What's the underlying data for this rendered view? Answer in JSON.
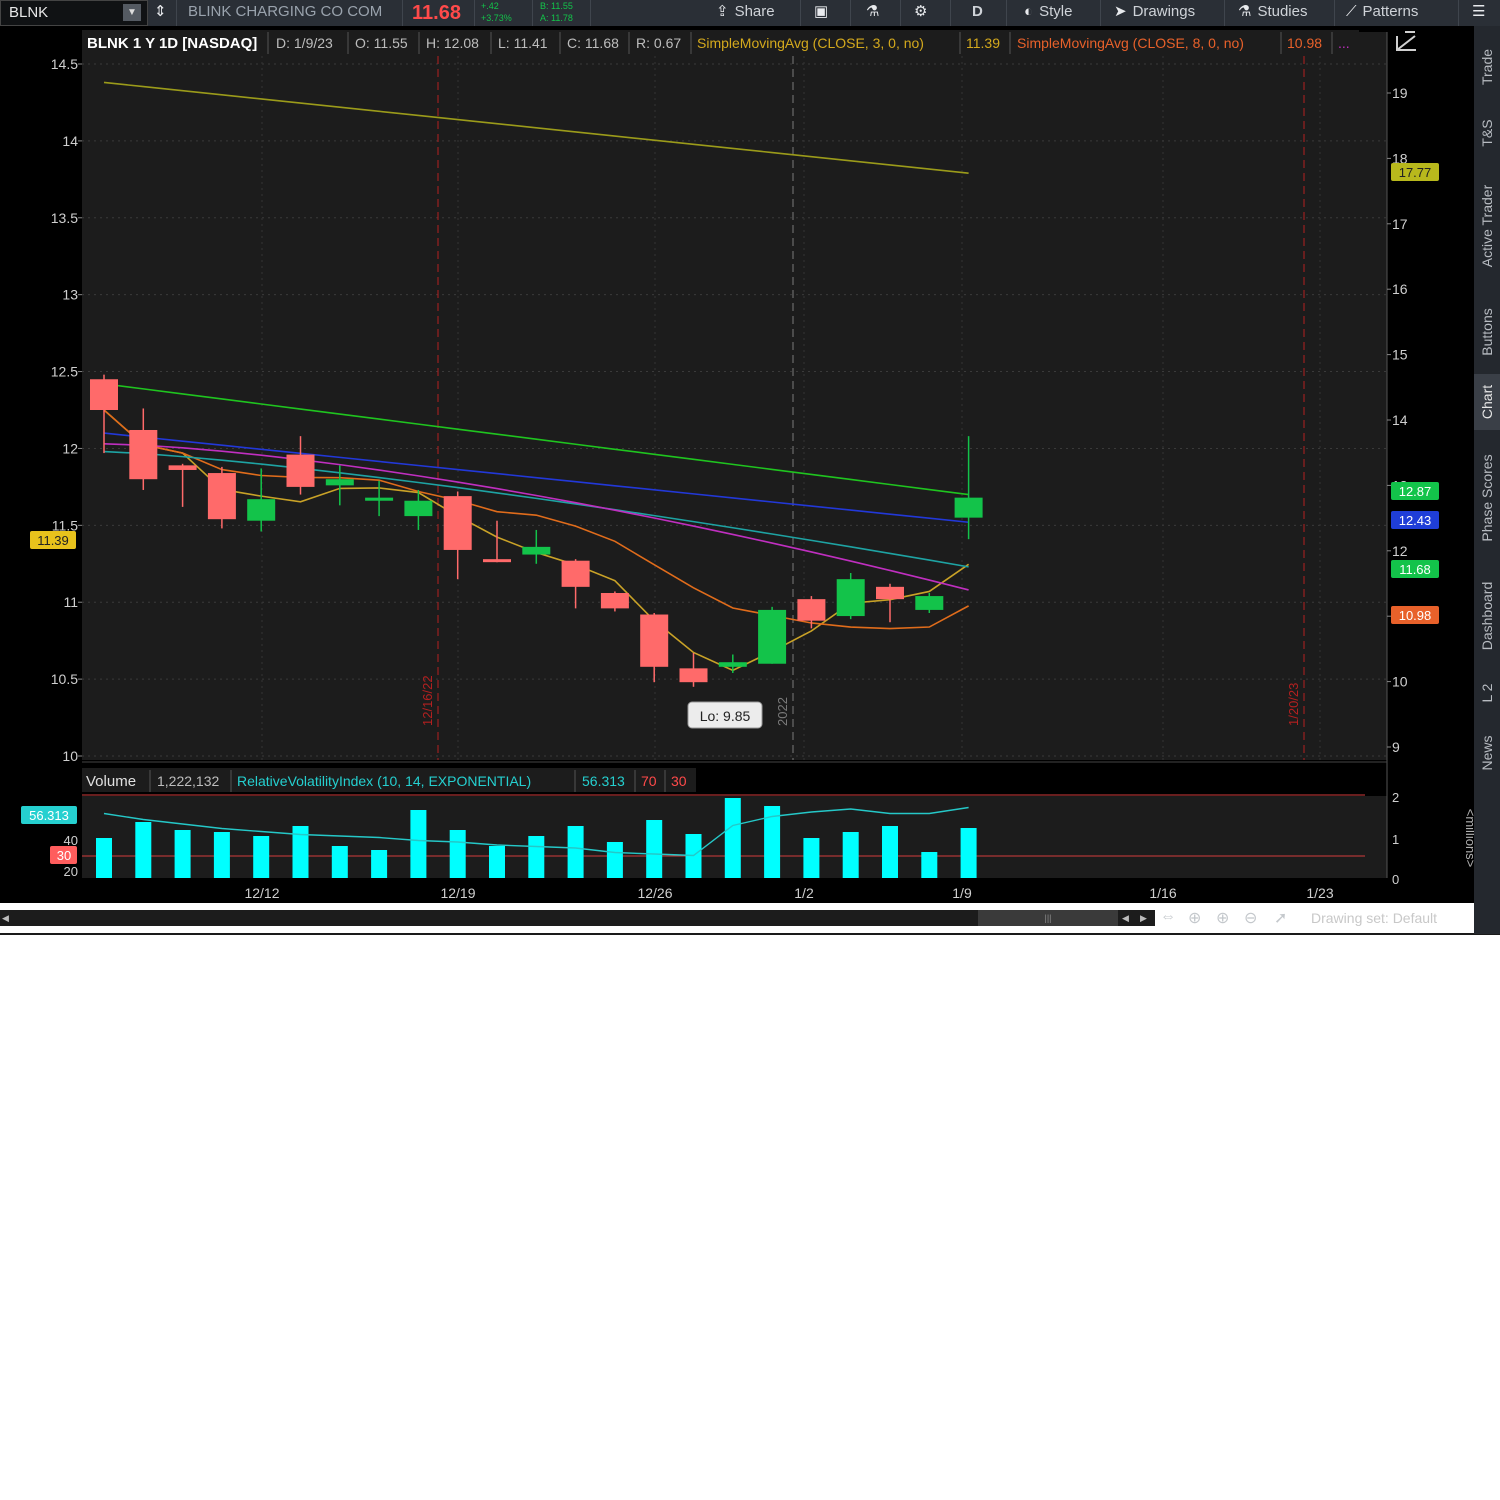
{
  "toolbar": {
    "symbol": "BLNK",
    "company": "BLINK CHARGING CO COM",
    "last_price": "11.68",
    "change": "+.42",
    "change_pct": "+3.73%",
    "bid": "B: 11.55",
    "ask": "A: 11.78",
    "share": "Share",
    "timeframe": "D",
    "style": "Style",
    "drawings": "Drawings",
    "studies": "Studies",
    "patterns": "Patterns"
  },
  "header": {
    "title": "BLNK 1 Y 1D [NASDAQ]",
    "date": "D: 1/9/23",
    "open": "O: 11.55",
    "high": "H: 12.08",
    "low": "L: 11.41",
    "close": "C: 11.68",
    "range": "R: 0.67",
    "sma3_label": "SimpleMovingAvg (CLOSE, 3, 0, no)",
    "sma3_value": "11.39",
    "sma8_label": "SimpleMovingAvg (CLOSE, 8, 0, no)",
    "sma8_value": "10.98",
    "more": "..."
  },
  "lower_header": {
    "volume_label": "Volume",
    "volume_value": "1,222,132",
    "rvi_label": "RelativeVolatilityIndex (10, 14, EXPONENTIAL)",
    "rvi_value": "56.313",
    "upper": "70",
    "lower": "30"
  },
  "colors": {
    "up": "#13c34a",
    "down": "#ff6a6a",
    "volume": "#00ffff",
    "sma3": "#c9a227",
    "sma8": "#e06c1b",
    "green_ma": "#1fc41f",
    "blue_ma": "#2238d8",
    "magenta_ma": "#c02fc0",
    "teal_ma": "#1ea3a3",
    "olive_ma": "#9b9b1a"
  },
  "chart_data": {
    "type": "candlestick",
    "title": "BLNK 1 Y 1D [NASDAQ]",
    "y_left_range": [
      10,
      14.5
    ],
    "y_left_ticks": [
      "14.5",
      "14",
      "13.5",
      "13",
      "12.5",
      "12",
      "11.5",
      "11",
      "10.5",
      "10"
    ],
    "y_right_ticks": [
      "19",
      "18",
      "17",
      "16",
      "15",
      "14",
      "13",
      "12",
      "11",
      "10",
      "9"
    ],
    "x_tick_labels": [
      "12/12",
      "12/19",
      "12/26",
      "1/2",
      "1/9",
      "1/16",
      "1/23"
    ],
    "period_markers": [
      "12/16/22",
      "2022",
      "1/20/23"
    ],
    "candles": [
      {
        "o": 12.45,
        "h": 12.48,
        "l": 11.97,
        "c": 12.25
      },
      {
        "o": 12.12,
        "h": 12.26,
        "l": 11.73,
        "c": 11.8
      },
      {
        "o": 11.89,
        "h": 11.9,
        "l": 11.62,
        "c": 11.86
      },
      {
        "o": 11.84,
        "h": 11.88,
        "l": 11.48,
        "c": 11.54
      },
      {
        "o": 11.53,
        "h": 11.87,
        "l": 11.46,
        "c": 11.67
      },
      {
        "o": 11.96,
        "h": 12.08,
        "l": 11.7,
        "c": 11.75
      },
      {
        "o": 11.76,
        "h": 11.89,
        "l": 11.63,
        "c": 11.8
      },
      {
        "o": 11.66,
        "h": 11.79,
        "l": 11.56,
        "c": 11.68
      },
      {
        "o": 11.56,
        "h": 11.73,
        "l": 11.47,
        "c": 11.66
      },
      {
        "o": 11.69,
        "h": 11.72,
        "l": 11.15,
        "c": 11.34
      },
      {
        "o": 11.28,
        "h": 11.53,
        "l": 11.26,
        "c": 11.27
      },
      {
        "o": 11.31,
        "h": 11.47,
        "l": 11.25,
        "c": 11.36
      },
      {
        "o": 11.27,
        "h": 11.28,
        "l": 10.96,
        "c": 11.1
      },
      {
        "o": 11.06,
        "h": 11.07,
        "l": 10.94,
        "c": 10.96
      },
      {
        "o": 10.92,
        "h": 10.93,
        "l": 10.48,
        "c": 10.58
      },
      {
        "o": 10.57,
        "h": 10.67,
        "l": 10.45,
        "c": 10.48
      },
      {
        "o": 10.58,
        "h": 10.66,
        "l": 10.54,
        "c": 10.61
      },
      {
        "o": 10.6,
        "h": 10.97,
        "l": 10.6,
        "c": 10.95
      },
      {
        "o": 11.02,
        "h": 11.04,
        "l": 10.83,
        "c": 10.88
      },
      {
        "o": 10.91,
        "h": 11.19,
        "l": 10.89,
        "c": 11.15
      },
      {
        "o": 11.1,
        "h": 11.12,
        "l": 10.87,
        "c": 11.02
      },
      {
        "o": 10.95,
        "h": 11.06,
        "l": 10.93,
        "c": 11.04
      },
      {
        "o": 11.55,
        "h": 12.08,
        "l": 11.41,
        "c": 11.68
      }
    ],
    "volume": [
      1.0,
      1.4,
      1.2,
      1.15,
      1.05,
      1.3,
      0.8,
      0.7,
      1.7,
      1.2,
      0.8,
      1.05,
      1.3,
      0.9,
      1.45,
      1.1,
      2.0,
      1.8,
      1.0,
      1.15,
      1.3,
      0.65,
      1.25
    ],
    "volume_axis_ticks": [
      "2",
      "1",
      "0"
    ],
    "volume_unit": "<millions>",
    "rvi_axis_ticks": [
      "40",
      "20"
    ],
    "callout": "Lo: 9.85",
    "badges": {
      "left_price": "11.39",
      "rvi": "56.313",
      "rvi_lower": "30",
      "r1": "17.77",
      "r2": "12.87",
      "r3": "12.43",
      "r4": "11.68",
      "r5": "10.98"
    }
  },
  "sidebar": {
    "tabs": [
      "Trade",
      "T&S",
      "Active Trader",
      "Buttons",
      "Chart",
      "Phase Scores",
      "Dashboard",
      "L 2",
      "News"
    ]
  },
  "bottombar": {
    "drawing_set": "Drawing set: Default"
  }
}
